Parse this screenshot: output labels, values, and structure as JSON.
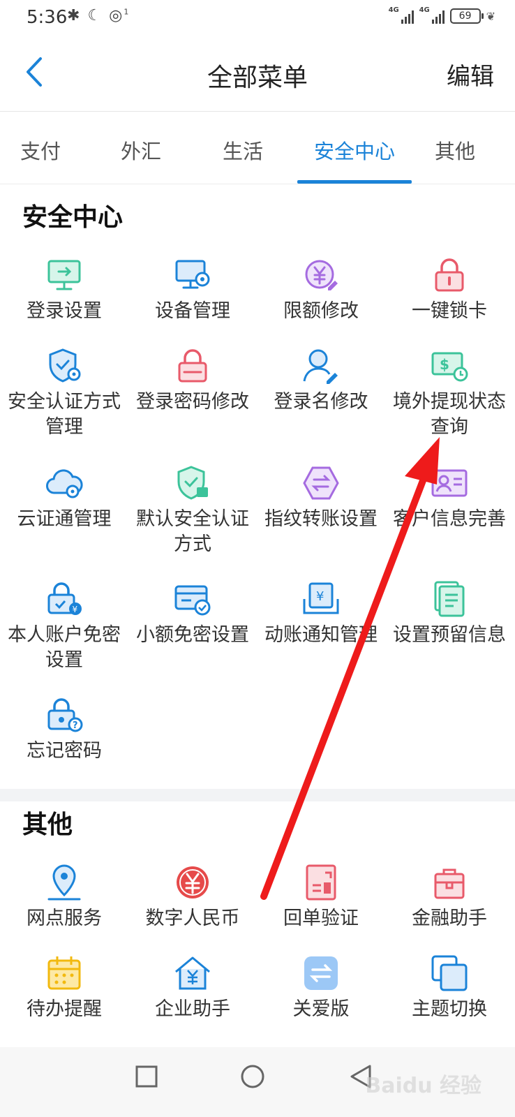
{
  "status_bar": {
    "time": "5:36",
    "left_icons": [
      "bluetooth-icon",
      "moon-icon",
      "hotspot-icon"
    ],
    "hotspot_count": "1",
    "signal_label_1": "4G",
    "signal_label_2": "4G",
    "battery": "69"
  },
  "navbar": {
    "title": "全部菜单",
    "edit_label": "编辑"
  },
  "tabs": [
    {
      "label": "支付"
    },
    {
      "label": "外汇"
    },
    {
      "label": "生活"
    },
    {
      "label": "安全中心",
      "active": true
    },
    {
      "label": "其他"
    }
  ],
  "security": {
    "title": "安全中心",
    "items": [
      {
        "label": "登录设置",
        "icon": "monitor-arrow-icon"
      },
      {
        "label": "设备管理",
        "icon": "device-settings-icon"
      },
      {
        "label": "限额修改",
        "icon": "yuan-edit-icon"
      },
      {
        "label": "一键锁卡",
        "icon": "lock-icon"
      },
      {
        "label": "安全认证方式管理",
        "icon": "shield-settings-icon"
      },
      {
        "label": "登录密码修改",
        "icon": "password-lock-icon"
      },
      {
        "label": "登录名修改",
        "icon": "user-edit-icon"
      },
      {
        "label": "境外提现状态查询",
        "icon": "cash-withdraw-icon"
      },
      {
        "label": "云证通管理",
        "icon": "cloud-icon"
      },
      {
        "label": "默认安全认证方式",
        "icon": "shield-default-icon"
      },
      {
        "label": "指纹转账设置",
        "icon": "transfer-hexagon-icon"
      },
      {
        "label": "客户信息完善",
        "icon": "id-card-icon"
      },
      {
        "label": "本人账户免密设置",
        "icon": "account-lock-icon"
      },
      {
        "label": "小额免密设置",
        "icon": "card-check-icon"
      },
      {
        "label": "动账通知管理",
        "icon": "yuan-notice-icon"
      },
      {
        "label": "设置预留信息",
        "icon": "document-icon"
      },
      {
        "label": "忘记密码",
        "icon": "forgot-lock-icon"
      }
    ]
  },
  "other": {
    "title": "其他",
    "items": [
      {
        "label": "网点服务",
        "icon": "location-pin-icon"
      },
      {
        "label": "数字人民币",
        "icon": "digital-yuan-icon"
      },
      {
        "label": "回单验证",
        "icon": "receipt-icon"
      },
      {
        "label": "金融助手",
        "icon": "briefcase-icon"
      },
      {
        "label": "待办提醒",
        "icon": "calendar-icon"
      },
      {
        "label": "企业助手",
        "icon": "house-yuan-icon"
      },
      {
        "label": "关爱版",
        "icon": "care-switch-icon"
      },
      {
        "label": "主题切换",
        "icon": "theme-switch-icon"
      }
    ]
  },
  "colors": {
    "accent": "#1b83d8",
    "arrow": "#ee1b1b"
  },
  "system_nav": [
    "square-icon",
    "circle-icon",
    "triangle-back-icon"
  ],
  "watermark": "Baidu 经验"
}
